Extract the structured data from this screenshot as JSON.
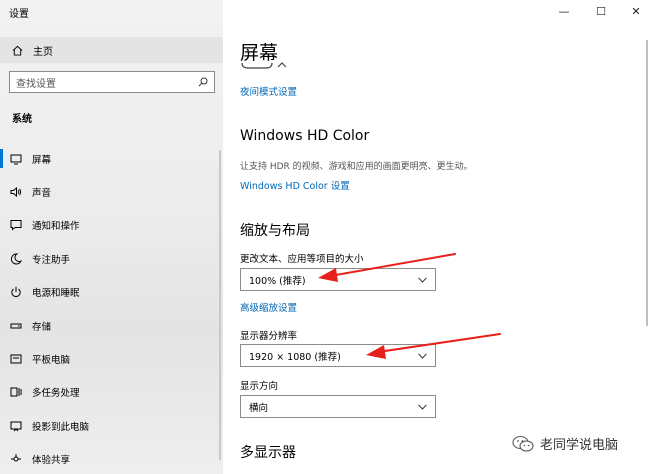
{
  "window": {
    "title": "设置",
    "controls": {
      "minimize": "—",
      "maximize": "☐",
      "close": "✕"
    }
  },
  "sidebar": {
    "home": "主页",
    "search_placeholder": "查找设置",
    "section": "系统",
    "items": [
      {
        "label": "屏幕",
        "icon": "monitor-icon",
        "active": true
      },
      {
        "label": "声音",
        "icon": "speaker-icon"
      },
      {
        "label": "通知和操作",
        "icon": "notification-icon"
      },
      {
        "label": "专注助手",
        "icon": "moon-icon"
      },
      {
        "label": "电源和睡眠",
        "icon": "power-icon"
      },
      {
        "label": "存储",
        "icon": "storage-icon"
      },
      {
        "label": "平板电脑",
        "icon": "tablet-icon"
      },
      {
        "label": "多任务处理",
        "icon": "multitask-icon"
      },
      {
        "label": "投影到此电脑",
        "icon": "project-icon"
      },
      {
        "label": "体验共享",
        "icon": "share-icon"
      }
    ]
  },
  "main": {
    "title": "屏幕",
    "night_light_link": "夜间模式设置",
    "hdr": {
      "heading": "Windows HD Color",
      "description": "让支持 HDR 的视频、游戏和应用的画面更明亮、更生动。",
      "link": "Windows HD Color 设置"
    },
    "scale": {
      "heading": "缩放与布局",
      "size_label": "更改文本、应用等项目的大小",
      "size_value": "100% (推荐)",
      "advanced_link": "高级缩放设置",
      "resolution_label": "显示器分辨率",
      "resolution_value": "1920 × 1080 (推荐)",
      "orientation_label": "显示方向",
      "orientation_value": "横向"
    },
    "multi_display_heading": "多显示器"
  },
  "watermark": "老同学说电脑",
  "colors": {
    "accent": "#0078d7",
    "link": "#0067b8",
    "arrow": "#e8201c"
  }
}
